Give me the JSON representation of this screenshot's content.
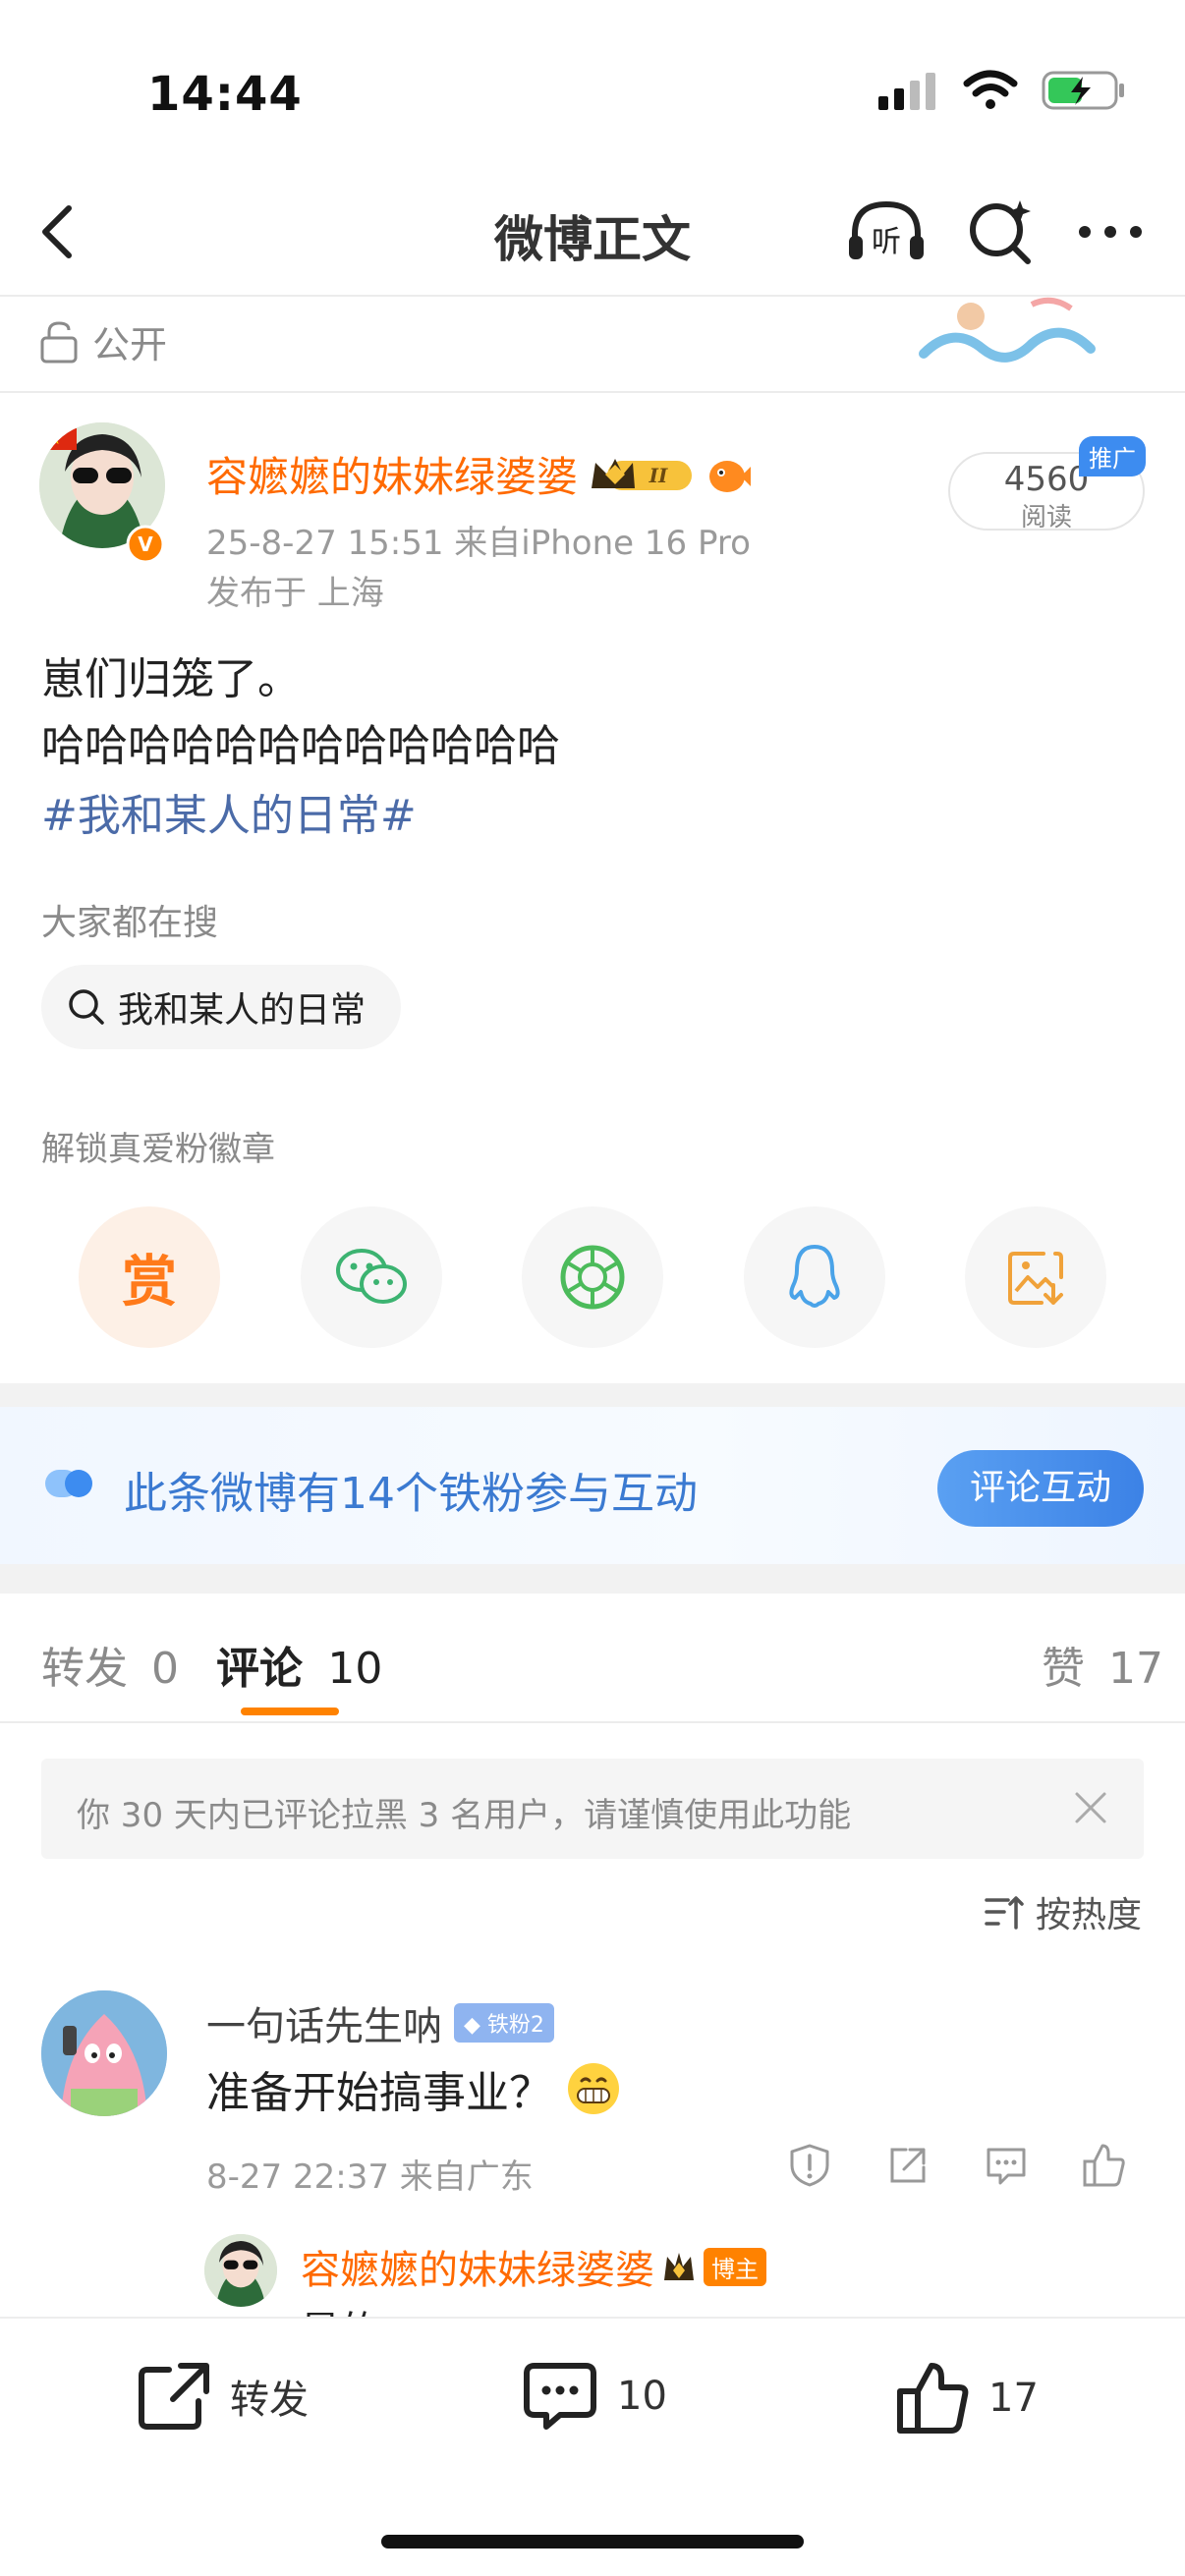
{
  "status_bar": {
    "time": "14:44"
  },
  "nav": {
    "title": "微博正文",
    "listen_label": "听"
  },
  "privacy": {
    "label": "公开"
  },
  "post": {
    "author": "容嬷嬷的妹妹绿婆婆",
    "member_level": "II",
    "meta": "25-8-27 15:51  来自iPhone 16 Pro",
    "location": "发布于 上海",
    "reads": "4560",
    "reads_label": "阅读",
    "promo_tag": "推广",
    "lines": [
      "崽们归笼了。",
      "哈哈哈哈哈哈哈哈哈哈哈哈"
    ],
    "hashtag": "#我和某人的日常#"
  },
  "hot_search": {
    "label": "大家都在搜",
    "chip": "我和某人的日常"
  },
  "unlock": {
    "label": "解锁真爱粉徽章"
  },
  "share": {
    "reward_label": "赏",
    "items": [
      "wechat-icon",
      "moments-icon",
      "qq-icon",
      "save-image-icon"
    ]
  },
  "fans_banner": {
    "text": "此条微博有14个铁粉参与互动",
    "button": "评论互动"
  },
  "tabs": {
    "repost": "转发",
    "repost_count": "0",
    "comment": "评论",
    "comment_count": "10",
    "like": "赞",
    "like_count": "17"
  },
  "notice": {
    "text": "你 30 天内已评论拉黑 3 名用户，请谨慎使用此功能"
  },
  "sort": {
    "label": "按热度"
  },
  "comments": [
    {
      "user": "一句话先生呐",
      "badge": "铁粉2",
      "text": "准备开始搞事业？",
      "meta": "8-27 22:37  来自广东"
    }
  ],
  "reply": {
    "user": "容嬷嬷的妹妹绿婆婆",
    "badge": "博主",
    "text": "是的"
  },
  "bottom_bar": {
    "repost": "转发",
    "comment_count": "10",
    "like_count": "17"
  },
  "colors": {
    "accent": "#ff8200",
    "link": "#4b6ba8",
    "blue": "#3b7ad1"
  }
}
